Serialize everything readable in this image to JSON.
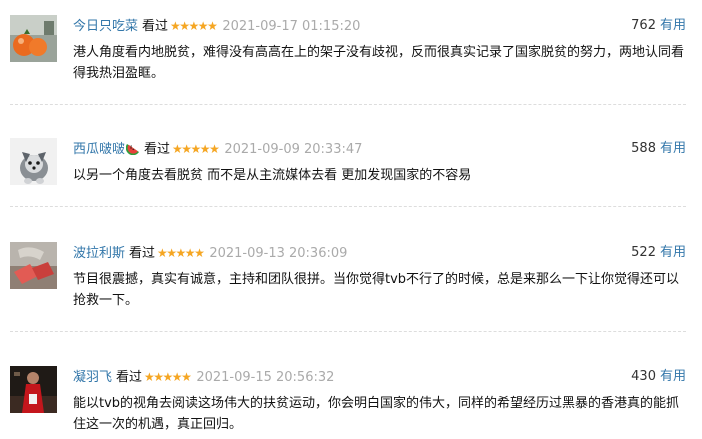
{
  "reviews": [
    {
      "user": "今日只吃菜",
      "rating_label": "看过",
      "stars": "★★★★★",
      "time": "2021-09-17 01:15:20",
      "useful_count": "762",
      "useful_label": "有用",
      "content": "港人角度看内地脱贫，难得没有高高在上的架子没有歧视，反而很真实记录了国家脱贫的努力，两地认同看得我热泪盈眶。"
    },
    {
      "user": "西瓜啵啵",
      "rating_label": "看过",
      "stars": "★★★★★",
      "time": "2021-09-09 20:33:47",
      "useful_count": "588",
      "useful_label": "有用",
      "content": "以另一个角度去看脱贫 而不是从主流媒体去看 更加发现国家的不容易"
    },
    {
      "user": "波拉利斯",
      "rating_label": "看过",
      "stars": "★★★★★",
      "time": "2021-09-13 20:36:09",
      "useful_count": "522",
      "useful_label": "有用",
      "content": "节目很震撼，真实有诚意，主持和团队很拼。当你觉得tvb不行了的时候，总是来那么一下让你觉得还可以抢救一下。"
    },
    {
      "user": "凝羽飞",
      "rating_label": "看过",
      "stars": "★★★★★",
      "time": "2021-09-15 20:56:32",
      "useful_count": "430",
      "useful_label": "有用",
      "content": "能以tvb的视角去阅读这场伟大的扶贫运动，你会明白国家的伟大，同样的希望经历过黑暴的香港真的能抓住这一次的机遇，真正回归。"
    }
  ],
  "colors": {
    "username": "#3377aa",
    "stars": "#f5a623",
    "time": "#aaaaaa",
    "text": "#111111"
  }
}
